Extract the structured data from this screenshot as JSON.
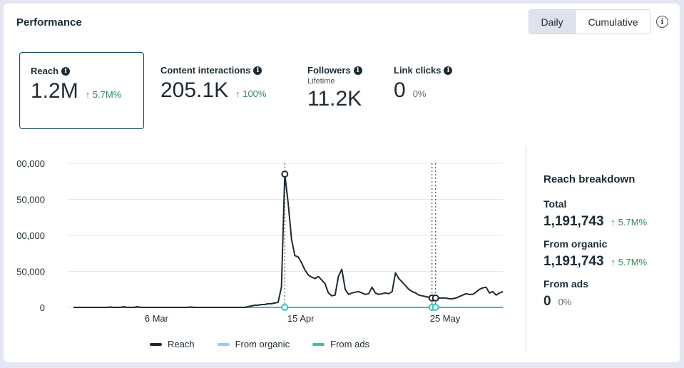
{
  "header": {
    "title": "Performance",
    "daily_label": "Daily",
    "cumulative_label": "Cumulative",
    "info_glyph": "i"
  },
  "metrics": [
    {
      "label": "Reach",
      "value": "1.2M",
      "change": "5.7M%",
      "arrow": "↑"
    },
    {
      "label": "Content interactions",
      "value": "205.1K",
      "change": "100%",
      "arrow": "↑"
    },
    {
      "label": "Followers",
      "sub": "Lifetime",
      "value": "11.2K"
    },
    {
      "label": "Link clicks",
      "value": "0",
      "change": "0%"
    }
  ],
  "breakdown": {
    "title": "Reach breakdown",
    "items": [
      {
        "label": "Total",
        "value": "1,191,743",
        "change": "5.7M%",
        "arrow": "↑"
      },
      {
        "label": "From organic",
        "value": "1,191,743",
        "change": "5.7M%",
        "arrow": "↑"
      },
      {
        "label": "From ads",
        "value": "0",
        "change": "0%"
      }
    ]
  },
  "chart_data": {
    "type": "line",
    "y_tick_labels": [
      "00,000",
      "50,000",
      "00,000",
      "50,000",
      "0"
    ],
    "y_tick_values": [
      200000,
      150000,
      100000,
      50000,
      0
    ],
    "ylim": [
      0,
      200000
    ],
    "x_tick_labels": [
      "6 Mar",
      "15 Apr",
      "25 May"
    ],
    "x_tick_days": [
      23,
      63,
      103
    ],
    "x_range_days": [
      0,
      119
    ],
    "colors": {
      "reach": "#1c2b33",
      "organic": "#8fd0f5",
      "ads": "#35c2b8"
    },
    "series": [
      {
        "name": "Reach",
        "key": "reach",
        "values": [
          0,
          0,
          0,
          0,
          0,
          0,
          0,
          0,
          0,
          0,
          0,
          500,
          0,
          0,
          0,
          1000,
          0,
          0,
          0,
          1000,
          0,
          0,
          0,
          0,
          0,
          0,
          0,
          0,
          0,
          0,
          0,
          0,
          0,
          0,
          0,
          500,
          0,
          0,
          0,
          0,
          0,
          0,
          0,
          0,
          0,
          0,
          0,
          0,
          0,
          0,
          0,
          0,
          1000,
          2000,
          3000,
          3000,
          4000,
          4000,
          5000,
          5000,
          6000,
          7000,
          28000,
          185000,
          145000,
          95000,
          72000,
          70000,
          62000,
          52000,
          45000,
          42000,
          40000,
          43000,
          38000,
          33000,
          20000,
          16000,
          17000,
          43000,
          53000,
          25000,
          18000,
          20000,
          21000,
          22000,
          20000,
          18000,
          19000,
          28000,
          20000,
          18000,
          19000,
          20000,
          19000,
          22000,
          48000,
          40000,
          35000,
          30000,
          25000,
          22000,
          20000,
          17000,
          16000,
          15000,
          14000,
          13000,
          13000,
          13000,
          13000,
          13000,
          12000,
          12000,
          13000,
          15000,
          17000,
          19000,
          18000,
          18000,
          21000,
          25000,
          27000,
          28000,
          20000,
          22000,
          17000,
          20000,
          22000
        ]
      },
      {
        "name": "From organic",
        "key": "organic"
      },
      {
        "name": "From ads",
        "key": "ads"
      }
    ]
  }
}
